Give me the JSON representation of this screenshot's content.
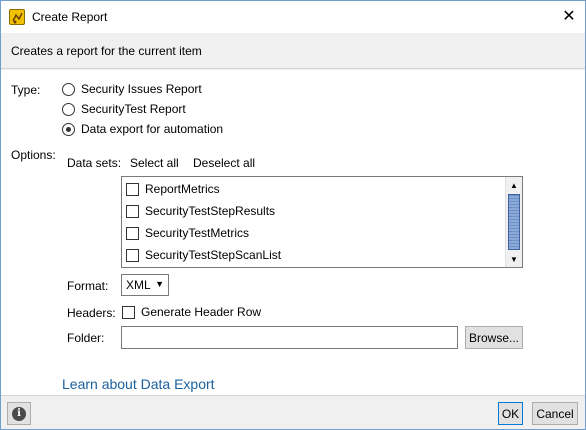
{
  "window": {
    "title": "Create Report",
    "close_glyph": "✕"
  },
  "header": {
    "description": "Creates a report for the current item"
  },
  "type": {
    "label": "Type:",
    "options": [
      {
        "label": "Security Issues Report",
        "selected": false
      },
      {
        "label": "SecurityTest Report",
        "selected": false
      },
      {
        "label": "Data export for automation",
        "selected": true
      }
    ]
  },
  "options": {
    "label": "Options:",
    "datasets_label": "Data sets:",
    "select_all": "Select all",
    "deselect_all": "Deselect all",
    "datasets": [
      {
        "label": "ReportMetrics",
        "checked": false
      },
      {
        "label": "SecurityTestStepResults",
        "checked": false
      },
      {
        "label": "SecurityTestMetrics",
        "checked": false
      },
      {
        "label": "SecurityTestStepScanList",
        "checked": false
      }
    ],
    "format_label": "Format:",
    "format_value": "XML",
    "headers_label": "Headers:",
    "headers_checkbox": "Generate Header Row",
    "folder_label": "Folder:",
    "folder_value": "",
    "browse": "Browse..."
  },
  "learn_link": "Learn about Data Export",
  "footer": {
    "ok": "OK",
    "cancel": "Cancel"
  },
  "icons": {
    "app": "report-app-icon",
    "info": "info-icon"
  },
  "colors": {
    "link": "#1a5f9e",
    "scroll_thumb": "#6b8fc6",
    "border_accent": "#0078d7"
  }
}
